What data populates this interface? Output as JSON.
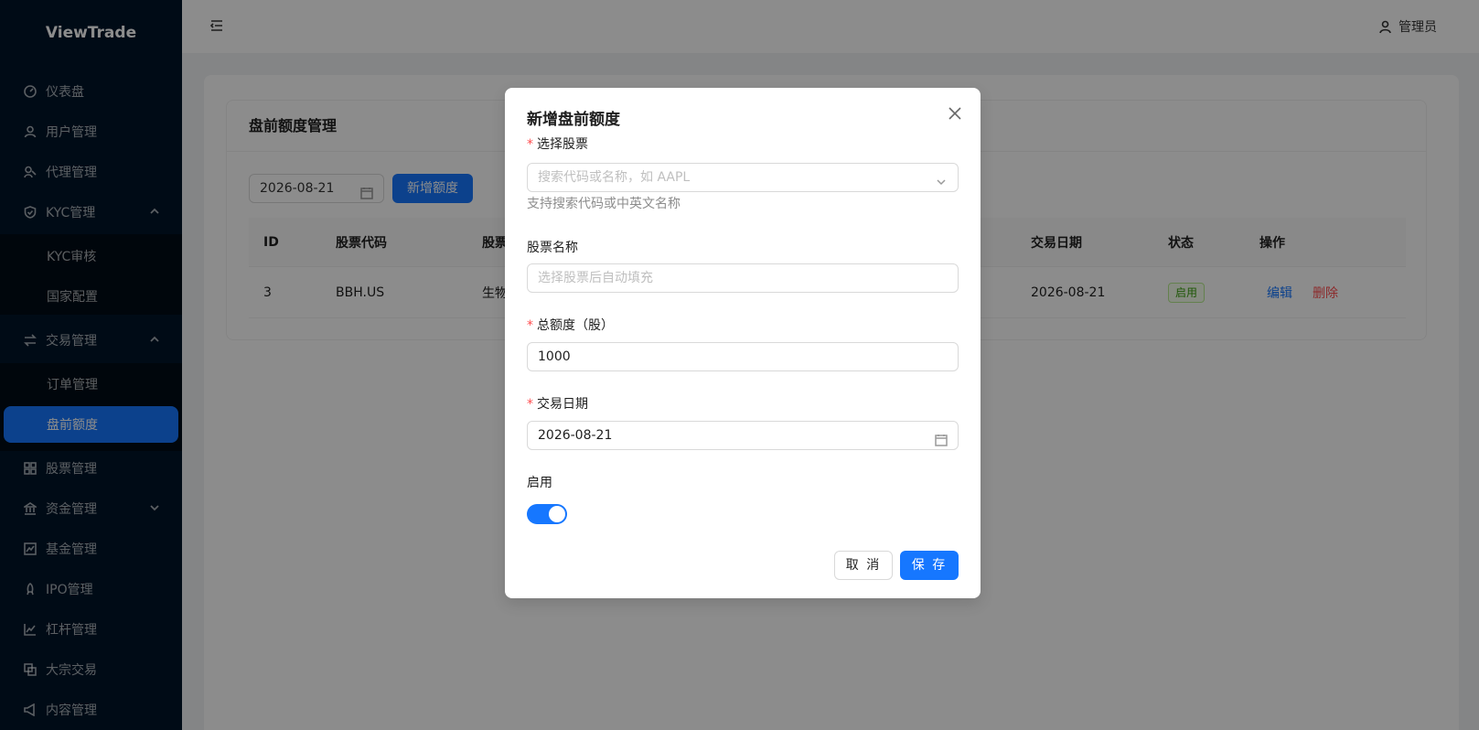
{
  "app": {
    "logo": "ViewTrade"
  },
  "sidebar": {
    "items": [
      {
        "label": "仪表盘",
        "icon": "dashboard-icon"
      },
      {
        "label": "用户管理",
        "icon": "user-icon"
      },
      {
        "label": "代理管理",
        "icon": "agent-icon"
      },
      {
        "label": "KYC管理",
        "icon": "shield-icon",
        "expanded": true
      },
      {
        "label": "KYC审核"
      },
      {
        "label": "国家配置"
      },
      {
        "label": "交易管理",
        "icon": "swap-icon",
        "expanded": true
      },
      {
        "label": "订单管理"
      },
      {
        "label": "盘前额度",
        "active": true
      },
      {
        "label": "股票管理",
        "icon": "grid-icon"
      },
      {
        "label": "资金管理",
        "icon": "bank-icon",
        "expanded": false
      },
      {
        "label": "基金管理",
        "icon": "fund-chart-icon"
      },
      {
        "label": "IPO管理",
        "icon": "rocket-icon"
      },
      {
        "label": "杠杆管理",
        "icon": "line-chart-icon"
      },
      {
        "label": "大宗交易",
        "icon": "block-trade-icon"
      },
      {
        "label": "内容管理",
        "icon": "notification-icon"
      }
    ]
  },
  "header": {
    "user": "管理员"
  },
  "page": {
    "title": "盘前额度管理",
    "date_filter": "2026-08-21",
    "add_button": "新增额度",
    "table": {
      "columns": [
        "ID",
        "股票代码",
        "股票",
        "交易日期",
        "状态",
        "操作"
      ],
      "rows": [
        {
          "id": "3",
          "code": "BBH.US",
          "name": "生物",
          "date": "2026-08-21",
          "status": "启用",
          "edit": "编辑",
          "delete": "删除"
        }
      ]
    }
  },
  "modal": {
    "title": "新增盘前额度",
    "stock_label": "选择股票",
    "stock_placeholder": "搜索代码或名称，如 AAPL",
    "stock_help": "支持搜索代码或中英文名称",
    "name_label": "股票名称",
    "name_placeholder": "选择股票后自动填充",
    "quota_label": "总额度（股）",
    "quota_value": "1000",
    "date_label": "交易日期",
    "date_value": "2026-08-21",
    "enable_label": "启用",
    "enabled": true,
    "cancel": "取 消",
    "save": "保 存"
  },
  "colors": {
    "primary": "#1677ff",
    "sidebar_bg": "#001529",
    "danger": "#ff4d4f",
    "success": "#389e0d"
  }
}
